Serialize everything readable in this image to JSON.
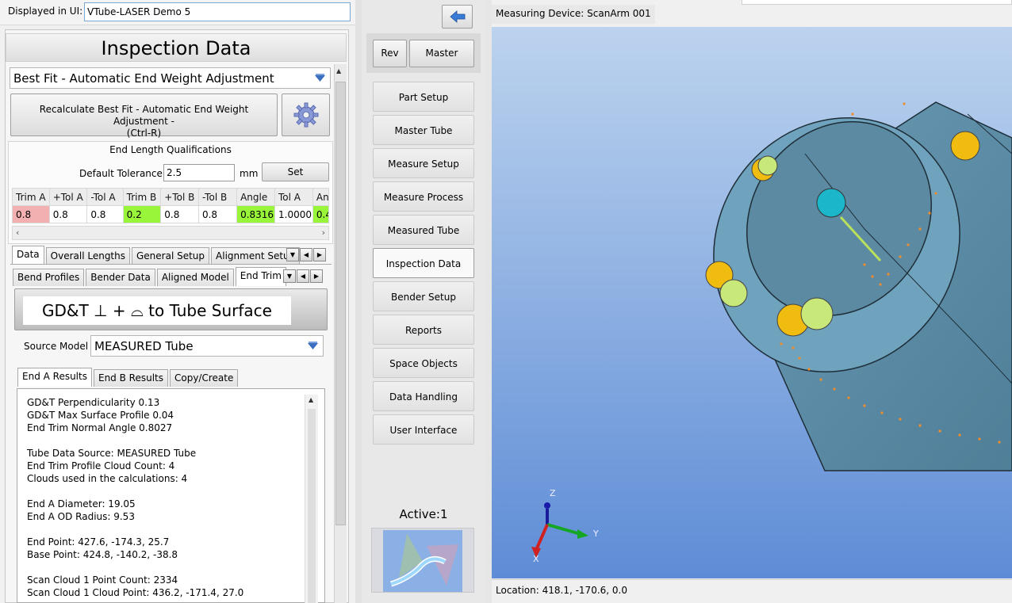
{
  "header": {
    "displayed_label": "Displayed in UI:",
    "displayed_value": "VTube-LASER Demo 5"
  },
  "panel": {
    "title": "Inspection Data",
    "method_select": "Best Fit - Automatic End Weight Adjustment",
    "recalc_line1": "Recalculate Best Fit - Automatic End Weight Adjustment -",
    "recalc_line2": "(Ctrl-R)",
    "qual_title": "End Length Qualifications",
    "default_tol_label": "Default Tolerance",
    "default_tol_value": "2.5",
    "default_tol_unit": "mm",
    "set_label": "Set"
  },
  "qual_table": {
    "headers": [
      "Trim A",
      "+Tol A",
      "-Tol A",
      "Trim B",
      "+Tol B",
      "-Tol B",
      "Angle",
      "Tol A",
      "An"
    ],
    "values": [
      "0.8",
      "0.8",
      "0.8",
      "0.2",
      "0.8",
      "0.8",
      "0.8316",
      "1.0000",
      "0.4"
    ],
    "colors": [
      "#f2b0b0",
      "#ffffff",
      "#ffffff",
      "#99f53a",
      "#ffffff",
      "#ffffff",
      "#99f53a",
      "#ffffff",
      "#99f53a"
    ]
  },
  "tabs1": [
    "Data",
    "Overall Lengths",
    "General Setup",
    "Alignment Setup"
  ],
  "tabs2": [
    "Bend Profiles",
    "Bender Data",
    "Aligned Model",
    "End Trim"
  ],
  "gdt_banner": "GD&T ⊥ + ⌓ to Tube Surface",
  "source_model_label": "Source Model",
  "source_model_value": "MEASURED Tube",
  "tabs3": [
    "End A Results",
    "End B Results",
    "Copy/Create"
  ],
  "results": [
    "GD&T Perpendicularity 0.13",
    "GD&T Max Surface Profile 0.04",
    "End Trim Normal Angle 0.8027",
    "",
    "Tube Data Source: MEASURED Tube",
    "End Trim Profile Cloud Count: 4",
    "Clouds used in the calculations: 4",
    "",
    "End A Diameter: 19.05",
    "End A OD Radius: 9.53",
    "",
    "End Point: 427.6, -174.3, 25.7",
    "Base Point: 424.8, -140.2, -38.8",
    "",
    "Scan Cloud 1 Point Count: 2334",
    "Scan Cloud 1 Cloud Point: 436.2, -171.4, 27.0"
  ],
  "nav": {
    "rev": "Rev",
    "master": "Master",
    "items": [
      "Part Setup",
      "Master Tube",
      "Measure Setup",
      "Measure Process",
      "Measured Tube",
      "Inspection Data",
      "Bender Setup",
      "Reports",
      "Space Objects",
      "Data Handling",
      "User Interface"
    ],
    "active_index": 5,
    "active_label": "Active:1"
  },
  "viewport": {
    "device_label": "Measuring Device: ScanArm 001",
    "axis_z": "Z",
    "axis_y": "Y",
    "axis_x": "X",
    "location": "Location: 418.1, -170.6, 0.0"
  },
  "colors": {
    "accent": "#3a7bd5",
    "green_ok": "#99f53a",
    "red_bad": "#f2b0b0",
    "viewport_top": "#bcd3ee",
    "viewport_bottom": "#5e8cd6"
  }
}
